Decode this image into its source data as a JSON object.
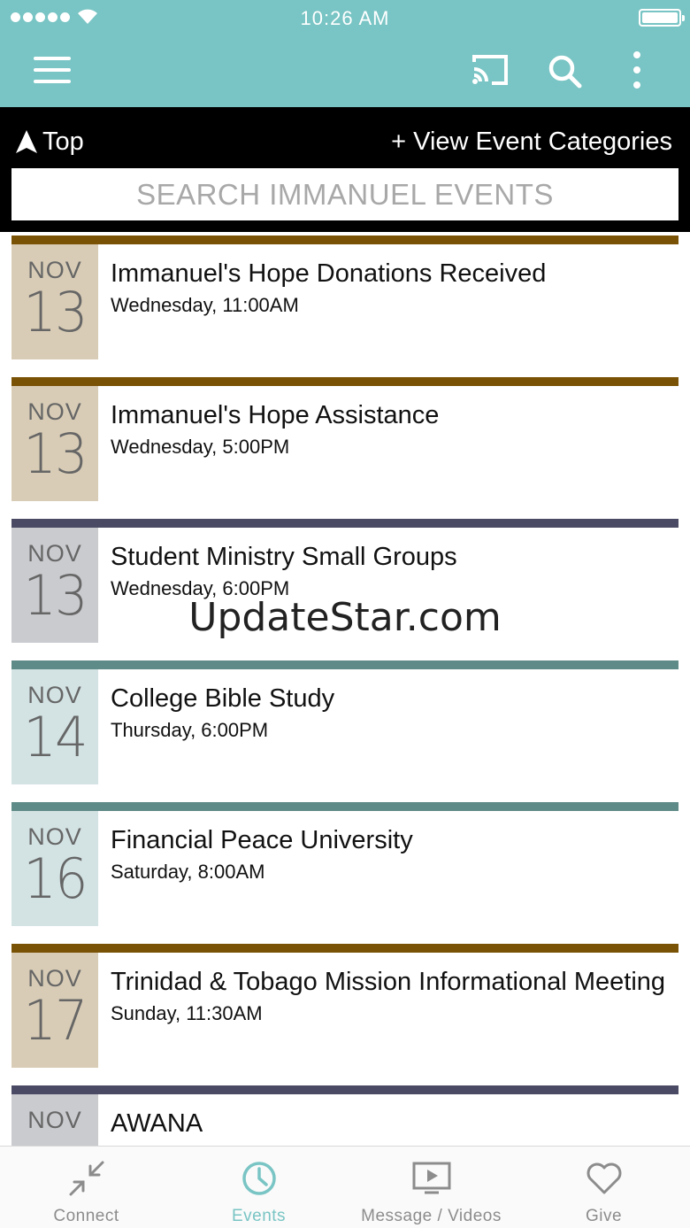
{
  "status_bar": {
    "time": "10:26 AM"
  },
  "header": {
    "top_label": "Top",
    "categories_label": "+ View Event Categories",
    "search_placeholder": "SEARCH IMMANUEL EVENTS"
  },
  "colors": {
    "app_bar": "#79c4c4",
    "accent_brown": "#7a5205",
    "accent_navy": "#4a4a64",
    "accent_teal": "#5e8a87",
    "date_tan": "#d8ccb6",
    "date_gray": "#cacbcf",
    "date_blue": "#d3e2e3"
  },
  "events": [
    {
      "month": "NOV",
      "day": "13",
      "title": "Immanuel's Hope Donations Received",
      "when": "Wednesday, 11:00AM",
      "bar": "#7a5205",
      "box": "#d8ccb6"
    },
    {
      "month": "NOV",
      "day": "13",
      "title": "Immanuel's Hope Assistance",
      "when": "Wednesday, 5:00PM",
      "bar": "#7a5205",
      "box": "#d8ccb6"
    },
    {
      "month": "NOV",
      "day": "13",
      "title": "Student Ministry Small Groups",
      "when": "Wednesday, 6:00PM",
      "bar": "#4a4a64",
      "box": "#cacbcf"
    },
    {
      "month": "NOV",
      "day": "14",
      "title": "College Bible Study",
      "when": "Thursday, 6:00PM",
      "bar": "#5e8a87",
      "box": "#d3e2e3"
    },
    {
      "month": "NOV",
      "day": "16",
      "title": "Financial Peace University",
      "when": "Saturday, 8:00AM",
      "bar": "#5e8a87",
      "box": "#d3e2e3"
    },
    {
      "month": "NOV",
      "day": "17",
      "title": "Trinidad & Tobago Mission Informational Meeting",
      "when": "Sunday, 11:30AM",
      "bar": "#7a5205",
      "box": "#d8ccb6"
    },
    {
      "month": "NOV",
      "day": "",
      "title": "AWANA",
      "when": "",
      "bar": "#4a4a64",
      "box": "#cacbcf"
    }
  ],
  "watermark": "UpdateStar.com",
  "tabs": [
    {
      "label": "Connect",
      "icon": "compress-arrows-icon",
      "active": false
    },
    {
      "label": "Events",
      "icon": "clock-icon",
      "active": true
    },
    {
      "label": "Message / Videos",
      "icon": "video-screen-icon",
      "active": false
    },
    {
      "label": "Give",
      "icon": "heart-icon",
      "active": false
    }
  ]
}
